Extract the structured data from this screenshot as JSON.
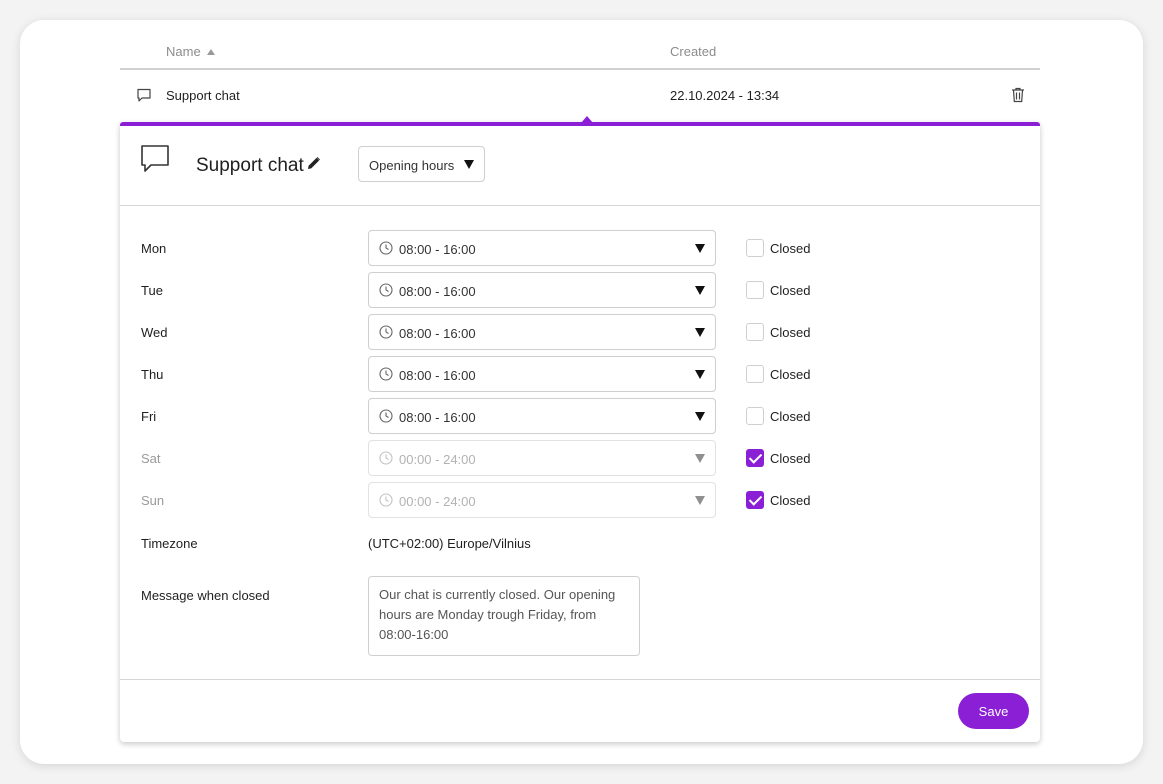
{
  "table": {
    "columns": {
      "name": "Name",
      "created": "Created"
    },
    "rows": [
      {
        "name": "Support chat",
        "created": "22.10.2024 - 13:34",
        "icon": "chat-bubble-icon"
      }
    ]
  },
  "panel": {
    "title": "Support chat",
    "mode_select": "Opening hours",
    "days": [
      {
        "day": "Mon",
        "hours": "08:00 - 16:00",
        "closed": false,
        "closed_label": "Closed"
      },
      {
        "day": "Tue",
        "hours": "08:00 - 16:00",
        "closed": false,
        "closed_label": "Closed"
      },
      {
        "day": "Wed",
        "hours": "08:00 - 16:00",
        "closed": false,
        "closed_label": "Closed"
      },
      {
        "day": "Thu",
        "hours": "08:00 - 16:00",
        "closed": false,
        "closed_label": "Closed"
      },
      {
        "day": "Fri",
        "hours": "08:00 - 16:00",
        "closed": false,
        "closed_label": "Closed"
      },
      {
        "day": "Sat",
        "hours": "00:00 - 24:00",
        "closed": true,
        "closed_label": "Closed"
      },
      {
        "day": "Sun",
        "hours": "00:00 - 24:00",
        "closed": true,
        "closed_label": "Closed"
      }
    ],
    "timezone_label": "Timezone",
    "timezone_value": "(UTC+02:00) Europe/Vilnius",
    "message_label": "Message when closed",
    "message_value": "Our chat is currently closed. Our opening hours are Monday trough Friday, from 08:00-16:00",
    "save_label": "Save"
  },
  "colors": {
    "accent": "#8a1fd6"
  }
}
